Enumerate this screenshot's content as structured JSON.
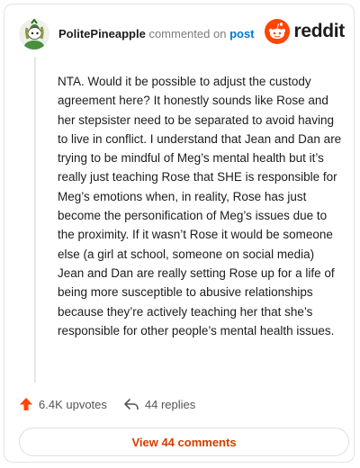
{
  "header": {
    "username": "PolitePineapple",
    "action_text": "commented on",
    "post_link": "post",
    "brand_name": "reddit"
  },
  "comment": {
    "body": "NTA. Would it be possible to adjust the custody agreement here? It honestly sounds like Rose and her stepsister need to be separated to avoid having to live in conflict. I understand that Jean and Dan are trying to be mindful of Meg’s mental health but it’s really just teaching Rose that SHE is responsible for Meg’s emotions when, in reality, Rose has just become the personification of Meg’s issues due to the proximity. If it wasn’t Rose it would be someone else (a girl at school, someone on social media) Jean and Dan are really setting Rose up for a life of being more susceptible to abusive relationships because they’re actively teaching her that she’s responsible for other people’s mental health issues."
  },
  "actions": {
    "upvotes": "6.4K upvotes",
    "replies": "44 replies",
    "view_comments": "View 44 comments"
  },
  "icons": {
    "upvote": "arrow-up-icon",
    "reply": "reply-arrow-icon",
    "brand": "reddit-snoo-icon",
    "avatar": "snoo-avatar"
  },
  "colors": {
    "brand_orange": "#ff4500",
    "link_blue": "#0079d3",
    "button_text": "#d93a00",
    "text": "#1c1c1c",
    "muted": "#7c7c7c"
  }
}
